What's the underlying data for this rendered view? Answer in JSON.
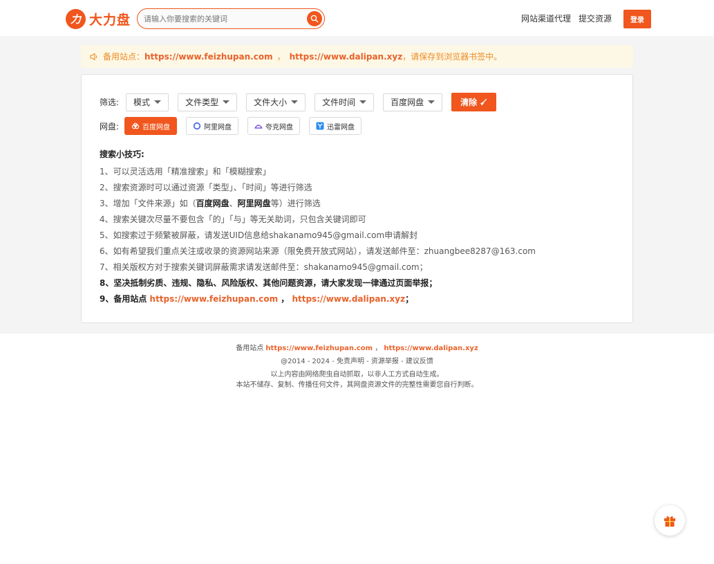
{
  "header": {
    "logo_mark": "力",
    "logo_text": "大力盘",
    "search_placeholder": "请输入你要搜索的关键词",
    "nav": [
      "网站渠道代理",
      "提交资源"
    ],
    "login_label": "登录"
  },
  "notice": {
    "prefix": "备用站点：",
    "url1": "https://www.feizhupan.com",
    "sep": "，",
    "url2": "https://www.dalipan.xyz",
    "suffix": "，请保存到浏览器书签中。"
  },
  "filters": {
    "label": "筛选:",
    "dropdowns": [
      "模式",
      "文件类型",
      "文件大小",
      "文件时间",
      "百度网盘"
    ],
    "clear_label": "清除"
  },
  "pans": {
    "label": "网盘:",
    "items": [
      {
        "label": "百度网盘",
        "icon": "cloud-icon",
        "active": true
      },
      {
        "label": "阿里网盘",
        "icon": "ring-icon",
        "active": false
      },
      {
        "label": "夸克网盘",
        "icon": "quark-icon",
        "active": false
      },
      {
        "label": "迅雷网盘",
        "icon": "thunder-icon",
        "active": false
      }
    ]
  },
  "tips": {
    "title": "搜索小技巧:",
    "t1": "1、可以灵活选用「精准搜索」和「模糊搜索」",
    "t2": "2、搜索资源时可以通过资源「类型」、「时间」等进行筛选",
    "t3_a": "3、增加「文件来源」如（",
    "t3_b1": "百度网盘",
    "t3_c": "、",
    "t3_b2": "阿里网盘",
    "t3_d": "等）进行筛选",
    "t4": "4、搜索关键次尽量不要包含「的」「与」等无关助词，只包含关键词即可",
    "t5": "5、如搜索过于频繁被屏蔽，请发送UID信息给shakanamo945@gmail.com申请解封",
    "t6": "6、如有希望我们重点关注或收录的资源网站来源（限免费开放式网站），请发送邮件至：zhuangbee8287@163.com",
    "t7": "7、相关版权方对于搜索关键词屏蔽需求请发送邮件至：shakanamo945@gmail.com；",
    "t8": "8、坚决抵制劣质、违规、隐私、风险版权、其他问题资源，请大家发现一律通过页面举报；",
    "t9_a": "9、备用站点 ",
    "t9_url1": "https://www.feizhupan.com",
    "t9_sep": " ， ",
    "t9_url2": "https://www.dalipan.xyz",
    "t9_end": "；"
  },
  "footer": {
    "backup_prefix": "备用站点 ",
    "url1": "https://www.feizhupan.com",
    "sep": " ， ",
    "url2": "https://www.dalipan.xyz",
    "copyright": "@2014 - 2024",
    "dash": " - ",
    "links": [
      "免责声明",
      "资源举报",
      "建议反馈"
    ],
    "line3": "以上内容由网络爬虫自动抓取，以非人工方式自动生成。",
    "line4": "本站不储存、复制、传播任何文件，其网盘资源文件的完整性需要您自行判断。"
  },
  "colors": {
    "accent": "#f0561d",
    "link": "#e8622b",
    "notice_text": "#ed8b25",
    "notice_bg": "#fdf8e6"
  }
}
